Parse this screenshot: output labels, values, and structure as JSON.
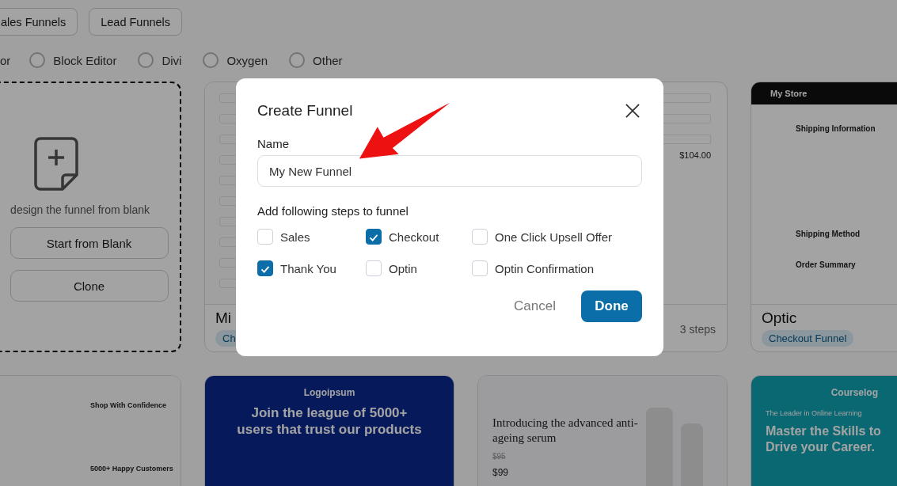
{
  "category_tabs": [
    {
      "label": "ales Funnels"
    },
    {
      "label": "Lead Funnels"
    }
  ],
  "builder_option_cut": "or",
  "builder_options": [
    {
      "label": "Block Editor",
      "selected": false
    },
    {
      "label": "Divi",
      "selected": false
    },
    {
      "label": "Oxygen",
      "selected": false
    },
    {
      "label": "Other",
      "selected": false
    }
  ],
  "blank_card": {
    "text": "design the funnel from blank",
    "buttons": [
      "Start from Blank",
      "Clone"
    ]
  },
  "templates": [
    {
      "preview": {
        "kind": "form"
      },
      "name": "Mi",
      "tag": "Ch"
    },
    {
      "preview": {
        "kind": "summary",
        "texts": [
          {
            "kind": "price",
            "text": "$104.00"
          }
        ]
      },
      "steps": "3 steps"
    },
    {
      "preview": {
        "kind": "store",
        "texts": [
          {
            "kind": "brand",
            "text": "My Store"
          },
          {
            "kind": "section",
            "text": "Shipping Information"
          },
          {
            "kind": "section",
            "text": "Shipping Method"
          },
          {
            "kind": "section",
            "text": "Order Summary"
          }
        ]
      },
      "name": "Optic",
      "tag": "Checkout Funnel"
    },
    {
      "preview": {
        "kind": "form",
        "texts": [
          {
            "kind": "section",
            "text": "Shop With Confidence"
          },
          {
            "kind": "section",
            "text": "5000+ Happy Customers"
          }
        ]
      }
    },
    {
      "preview": {
        "kind": "blue",
        "texts": [
          {
            "kind": "brand",
            "text": "Logoipsum"
          },
          {
            "kind": "headline",
            "text": "Join the league of 5000+ users that trust our products"
          }
        ]
      }
    },
    {
      "preview": {
        "kind": "serum",
        "texts": [
          {
            "kind": "headline",
            "text": "Introducing the advanced anti-ageing serum"
          },
          {
            "kind": "old_price",
            "text": "$95"
          },
          {
            "kind": "price",
            "text": "$99"
          }
        ]
      }
    },
    {
      "preview": {
        "kind": "teal",
        "texts": [
          {
            "kind": "brand",
            "text": "Courselog"
          },
          {
            "kind": "kicker",
            "text": "The Leader in Online Learning"
          },
          {
            "kind": "headline",
            "text": "Master the Skills to Drive your Career."
          }
        ]
      }
    }
  ],
  "dialog": {
    "title": "Create Funnel",
    "name_label": "Name",
    "name_value": "My New Funnel",
    "steps_label": "Add following steps to funnel",
    "steps": [
      {
        "label": "Sales",
        "checked": false
      },
      {
        "label": "Checkout",
        "checked": true
      },
      {
        "label": "One Click Upsell Offer",
        "checked": false
      },
      {
        "label": "Thank You",
        "checked": true
      },
      {
        "label": "Optin",
        "checked": false
      },
      {
        "label": "Optin Confirmation",
        "checked": false
      }
    ],
    "cancel": "Cancel",
    "done": "Done"
  }
}
